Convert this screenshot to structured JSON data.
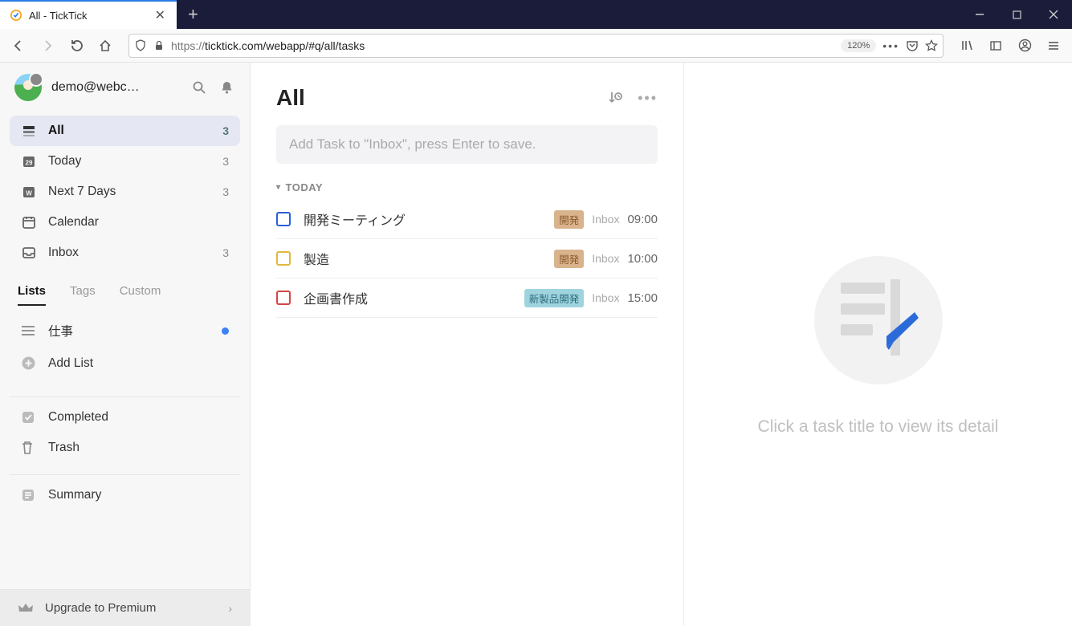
{
  "browser": {
    "tab_title": "All - TickTick",
    "url_display": "ticktick.com/webapp/#q/all/tasks",
    "url_prefix": "https://",
    "zoom": "120%"
  },
  "sidebar": {
    "user": "demo@webc…",
    "nav": [
      {
        "icon": "inbox-stack",
        "label": "All",
        "count": "3",
        "active": true
      },
      {
        "icon": "calendar-day",
        "label": "Today",
        "count": "3",
        "day": "29"
      },
      {
        "icon": "calendar-week",
        "label": "Next 7 Days",
        "count": "3",
        "mark": "W"
      },
      {
        "icon": "calendar",
        "label": "Calendar",
        "count": ""
      },
      {
        "icon": "inbox",
        "label": "Inbox",
        "count": "3"
      }
    ],
    "tabs": [
      "Lists",
      "Tags",
      "Custom"
    ],
    "tabs_active": 0,
    "lists": [
      {
        "label": "仕事",
        "has_dot": true
      }
    ],
    "add_list": "Add List",
    "bottom": [
      {
        "icon": "check-square",
        "label": "Completed"
      },
      {
        "icon": "trash",
        "label": "Trash"
      }
    ],
    "summary": "Summary",
    "premium": "Upgrade to Premium"
  },
  "tasks": {
    "title": "All",
    "add_placeholder": "Add Task to \"Inbox\", press Enter to save.",
    "section": "TODAY",
    "items": [
      {
        "title": "開発ミーティング",
        "tag": "開発",
        "tag_bg": "#d9b38c",
        "tag_color": "#8a5a2b",
        "list": "Inbox",
        "time": "09:00",
        "check_color": "#2b5fd9"
      },
      {
        "title": "製造",
        "tag": "開発",
        "tag_bg": "#d9b38c",
        "tag_color": "#8a5a2b",
        "list": "Inbox",
        "time": "10:00",
        "check_color": "#e0b83d"
      },
      {
        "title": "企画書作成",
        "tag": "新製品開発",
        "tag_bg": "#9fd4df",
        "tag_color": "#2a6b7a",
        "list": "Inbox",
        "time": "15:00",
        "check_color": "#d64545"
      }
    ]
  },
  "detail": {
    "hint": "Click a task title to view its detail"
  }
}
